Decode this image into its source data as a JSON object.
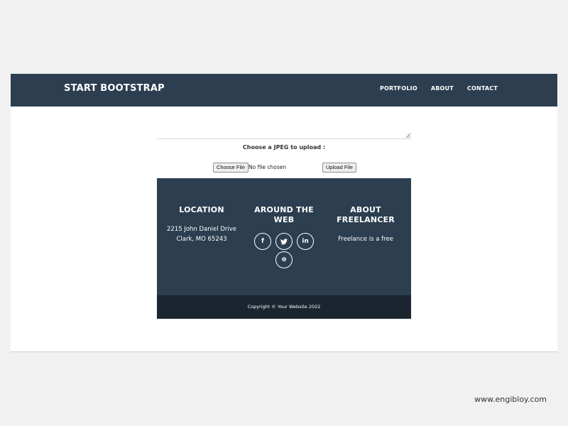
{
  "navbar": {
    "brand": "START BOOTSTRAP",
    "links": [
      "PORTFOLIO",
      "ABOUT",
      "CONTACT"
    ]
  },
  "form": {
    "upload_label": "Choose a JPEG to upload :",
    "choose_file_label": "Choose File",
    "file_status": "No file chosen",
    "upload_button_label": "Upload File"
  },
  "footer": {
    "location": {
      "title": "LOCATION",
      "lines": [
        "2215 John Daniel Drive",
        "Clark, MO 65243"
      ]
    },
    "around": {
      "title": "AROUND THE WEB",
      "socials": [
        {
          "icon": "facebook-icon",
          "glyph": "f"
        },
        {
          "icon": "twitter-icon",
          "glyph": "🐦"
        },
        {
          "icon": "linkedin-icon",
          "glyph": "in"
        },
        {
          "icon": "dribbble-icon",
          "glyph": "⊛"
        }
      ]
    },
    "about": {
      "title": "ABOUT FREELANCER",
      "text": "Freelance is a free"
    },
    "copyright": "Copyright © Your Website 2022"
  },
  "watermark": "www.engibloy.com",
  "colors": {
    "navbar": "#2c3e50",
    "footer": "#2c3e50",
    "copyright_bar": "#1a252f"
  }
}
